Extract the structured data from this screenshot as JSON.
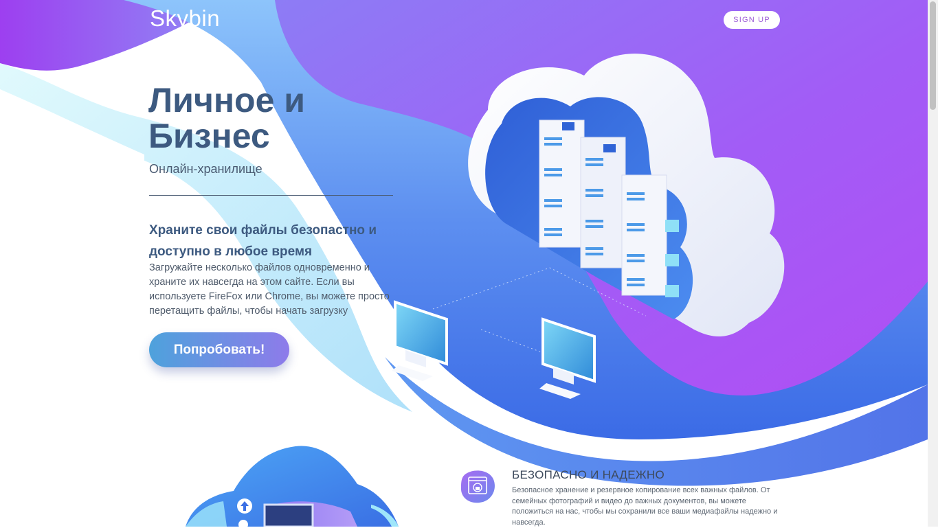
{
  "header": {
    "logo": "Skybin",
    "signup_label": "SIGN UP"
  },
  "hero": {
    "title_line1": "Личное и",
    "title_line2": "Бизнес",
    "subtitle": "Онлайн-хранилище",
    "feature_heading": "Храните свои файлы безопастно и доступно в любое время",
    "feature_text": "Загружайте несколько файлов одновременно и храните их навсегда на этом сайте. Если вы используете FireFox или Chrome, вы можете просто перетащить файлы, чтобы начать загрузку",
    "cta_label": "Попробовать!"
  },
  "features": {
    "secure": {
      "title": "БЕЗОПАСНО И НАДЕЖНО",
      "text": "Безопасное хранение и резервное копирование всех важных файлов. От семейных фотографий и видео до важных документов, вы можете положиться на нас, чтобы мы сохранили все ваши медиафайлы надежно и навсегда."
    }
  },
  "colors": {
    "accent_purple": "#a35bf2",
    "accent_blue": "#3a6ee6",
    "heading_navy": "#3d5a80"
  },
  "icons": {
    "secure_icon": "lock-window-icon",
    "upload_icon": "arrow-up-icon"
  }
}
